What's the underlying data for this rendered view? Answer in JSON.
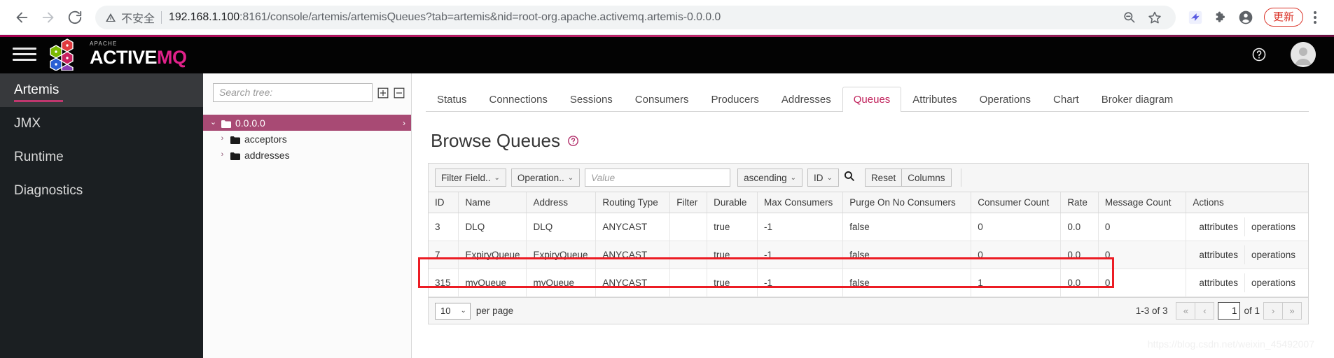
{
  "browser": {
    "back_icon": "arrow-left-icon",
    "forward_icon": "arrow-right-icon",
    "reload_icon": "reload-icon",
    "warning_icon": "warning-triangle-icon",
    "not_secure_label": "不安全",
    "url_host": "192.168.1.100",
    "url_rest": ":8161/console/artemis/artemisQueues?tab=artemis&nid=root-org.apache.activemq.artemis-0.0.0.0",
    "zoom_out_icon": "zoom-out-icon",
    "bookmark_icon": "star-icon",
    "extension_bird_icon": "bird-extension-icon",
    "extensions_icon": "puzzle-piece-icon",
    "profile_icon": "profile-avatar-icon",
    "update_label": "更新",
    "menu_icon": "kebab-menu-icon"
  },
  "app_header": {
    "hamburger_icon": "hamburger-menu-icon",
    "logo_apache": "APACHE",
    "logo_active": "ACTIVE",
    "logo_mq": "MQ",
    "help_icon": "help-circle-icon",
    "avatar_icon": "user-avatar-icon"
  },
  "sidebar": {
    "items": [
      {
        "label": "Artemis",
        "active": true
      },
      {
        "label": "JMX",
        "active": false
      },
      {
        "label": "Runtime",
        "active": false
      },
      {
        "label": "Diagnostics",
        "active": false
      }
    ]
  },
  "tree": {
    "search_placeholder": "Search tree:",
    "search_value": "",
    "expand_all_icon": "expand-all-icon",
    "collapse_all_icon": "collapse-all-icon",
    "nodes": [
      {
        "label": "0.0.0.0",
        "selected": true,
        "caret": "⌄",
        "depth": 0
      },
      {
        "label": "acceptors",
        "selected": false,
        "caret": "›",
        "depth": 1
      },
      {
        "label": "addresses",
        "selected": false,
        "caret": "›",
        "depth": 1
      }
    ]
  },
  "main": {
    "tabs": [
      {
        "label": "Status",
        "active": false
      },
      {
        "label": "Connections",
        "active": false
      },
      {
        "label": "Sessions",
        "active": false
      },
      {
        "label": "Consumers",
        "active": false
      },
      {
        "label": "Producers",
        "active": false
      },
      {
        "label": "Addresses",
        "active": false
      },
      {
        "label": "Queues",
        "active": true
      },
      {
        "label": "Attributes",
        "active": false
      },
      {
        "label": "Operations",
        "active": false
      },
      {
        "label": "Chart",
        "active": false
      },
      {
        "label": "Broker diagram",
        "active": false
      }
    ],
    "page_title": "Browse Queues",
    "page_help_icon": "help-circle-icon",
    "toolbar": {
      "filter_field_label": "Filter Field..",
      "operation_label": "Operation..",
      "value_placeholder": "Value",
      "value_current": "",
      "sort_direction_label": "ascending",
      "sort_field_label": "ID",
      "search_icon": "search-icon",
      "reset_label": "Reset",
      "columns_label": "Columns"
    },
    "table": {
      "headers": [
        "ID",
        "Name",
        "Address",
        "Routing Type",
        "Filter",
        "Durable",
        "Max Consumers",
        "Purge On No Consumers",
        "Consumer Count",
        "Rate",
        "Message Count",
        "Actions"
      ],
      "rows": [
        {
          "id": "3",
          "name": "DLQ",
          "address": "DLQ",
          "routing_type": "ANYCAST",
          "filter": "",
          "durable": "true",
          "max_consumers": "-1",
          "purge_on_no_consumers": "false",
          "consumer_count": "0",
          "rate": "0.0",
          "message_count": "0",
          "action_attributes": "attributes",
          "action_operations": "operations"
        },
        {
          "id": "7",
          "name": "ExpiryQueue",
          "address": "ExpiryQueue",
          "routing_type": "ANYCAST",
          "filter": "",
          "durable": "true",
          "max_consumers": "-1",
          "purge_on_no_consumers": "false",
          "consumer_count": "0",
          "rate": "0.0",
          "message_count": "0",
          "action_attributes": "attributes",
          "action_operations": "operations"
        },
        {
          "id": "315",
          "name": "myQueue",
          "address": "myQueue",
          "routing_type": "ANYCAST",
          "filter": "",
          "durable": "true",
          "max_consumers": "-1",
          "purge_on_no_consumers": "false",
          "consumer_count": "1",
          "rate": "0.0",
          "message_count": "0",
          "action_attributes": "attributes",
          "action_operations": "operations"
        }
      ]
    },
    "footer": {
      "per_page_value": "10",
      "per_page_label": "per page",
      "range_label": "1-3 of 3",
      "first_icon": "«",
      "prev_icon": "‹",
      "page_value": "1",
      "of_label": "of 1",
      "next_icon": "›",
      "last_icon": "»"
    }
  },
  "watermark": "https://blog.csdn.net/weixin_45492007",
  "colors": {
    "brand_pink": "#c0205a",
    "tree_selected": "#a84a74",
    "annotation_red": "#ec1c24",
    "header_black": "#030303",
    "sidebar_dark": "#1b1f22"
  }
}
